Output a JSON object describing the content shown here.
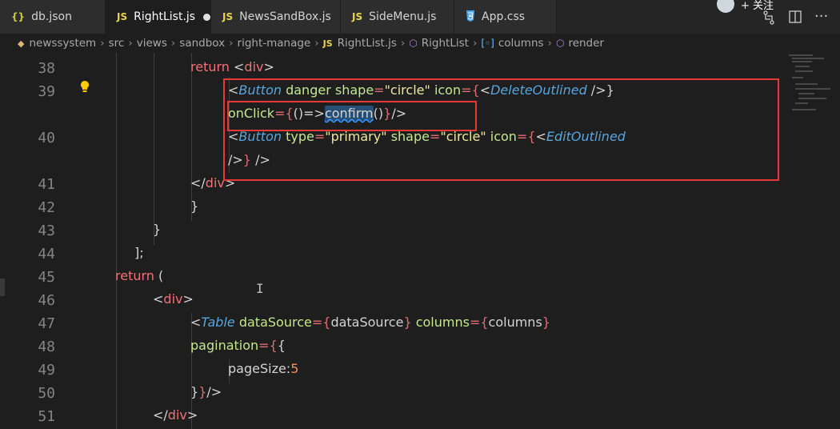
{
  "tabs": [
    {
      "icon": "{}",
      "label": "db.json",
      "active": false
    },
    {
      "icon": "JS",
      "label": "RightList.js",
      "active": true,
      "modified": true
    },
    {
      "icon": "JS",
      "label": "NewsSandBox.js",
      "active": false
    },
    {
      "icon": "JS",
      "label": "SideMenu.js",
      "active": false
    },
    {
      "icon": "css",
      "label": "App.css",
      "active": false
    }
  ],
  "top_right": {
    "follow_label": "+ 关注"
  },
  "breadcrumb": {
    "items": [
      "newssystem",
      "src",
      "views",
      "sandbox",
      "right-manage",
      "RightList.js",
      "RightList",
      "columns",
      "render"
    ]
  },
  "editor": {
    "line_numbers": [
      "38",
      "39",
      "",
      "40",
      "",
      "41",
      "42",
      "43",
      "44",
      "45",
      "46",
      "47",
      "48",
      "49",
      "50",
      "51"
    ],
    "code": {
      "l38": {
        "kw": "return",
        "open": "<",
        "tag": "div",
        "close": ">"
      },
      "l39": {
        "lt": "<",
        "comp": "Button",
        "attr1": "danger",
        "attr2": "shape",
        "eq": "=",
        "str": "\"circle\"",
        "attr3": "icon",
        "eqb": "={",
        "lt2": "<",
        "comp2": "DeleteOutlined",
        "end": " />}"
      },
      "l39b": {
        "attr": "onClick",
        "eqb": "={",
        "arrow": "()=>",
        "sel": "confirm",
        "rest": "()",
        "endb": "}",
        "end": "/>"
      },
      "l40": {
        "lt": "<",
        "comp": "Button",
        "attr1": "type",
        "eq1": "=",
        "str1": "\"primary\"",
        "attr2": "shape",
        "eq2": "=",
        "str2": "\"circle\"",
        "attr3": "icon",
        "eqb": "={",
        "lt2": "<",
        "comp2": "EditOutlined"
      },
      "l40b": {
        "a": "/>",
        "b": "}",
        "c": " />"
      },
      "l41": {
        "open": "</",
        "tag": "div",
        "close": ">"
      },
      "l42": {
        "text": "}"
      },
      "l43": {
        "text": "}"
      },
      "l44": {
        "text": "];"
      },
      "l45": {
        "kw": "return",
        "rest": " ("
      },
      "l46": {
        "open": "<",
        "tag": "div",
        "close": ">"
      },
      "l47": {
        "lt": "<",
        "comp": "Table",
        "attr1": "dataSource",
        "eqb": "={",
        "val1": "dataSource",
        "cb": "}",
        "attr2": "columns",
        "eqb2": "={",
        "val2": "columns",
        "cb2": "}"
      },
      "l48": {
        "attr": "pagination",
        "eqb": "={",
        "ob": "{"
      },
      "l49": {
        "key": "pageSize:",
        "num": "5"
      },
      "l50": {
        "a": "}",
        "b": "}",
        "c": "/>"
      },
      "l51": {
        "open": "</",
        "tag": "div",
        "close": ">"
      }
    }
  },
  "colors": {
    "highlight_box": "#e53935",
    "selection": "#264f78"
  }
}
